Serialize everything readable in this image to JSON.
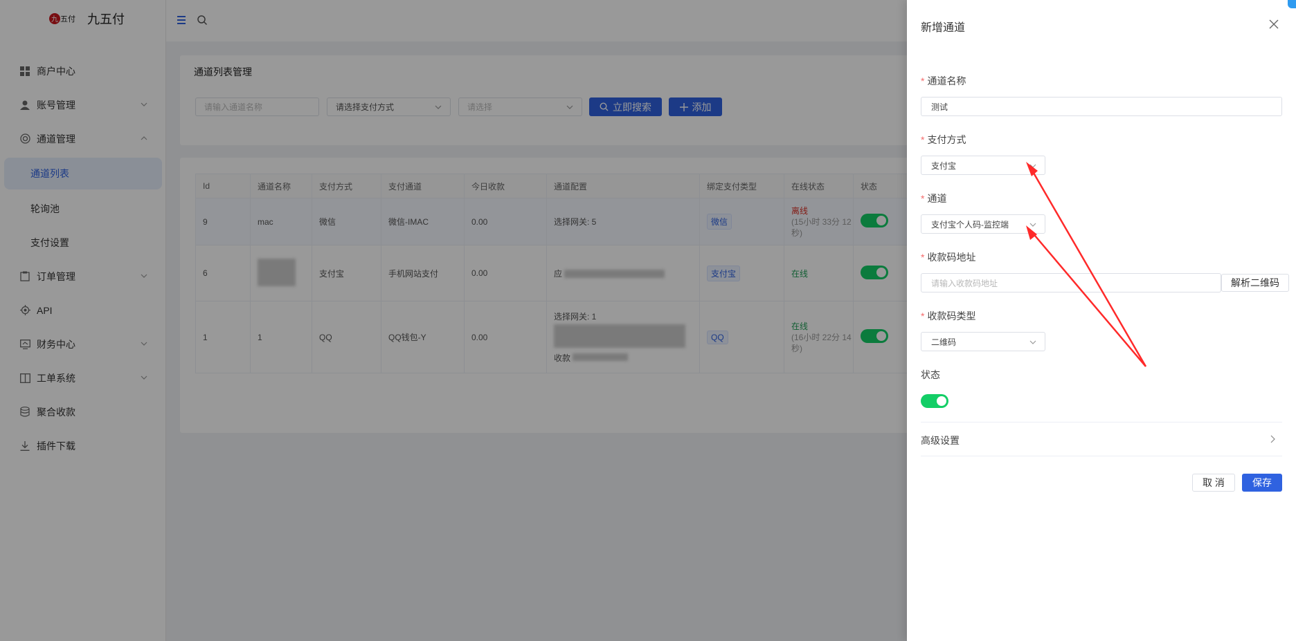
{
  "app": {
    "name": "九五付"
  },
  "sidebar": {
    "items": [
      {
        "label": "商户中心",
        "icon": "grid-icon"
      },
      {
        "label": "账号管理",
        "icon": "user-icon",
        "expandable": true
      },
      {
        "label": "通道管理",
        "icon": "channel-icon",
        "expandable": true,
        "expanded": true
      },
      {
        "label": "通道列表",
        "sub": true,
        "active": true
      },
      {
        "label": "轮询池",
        "sub": true
      },
      {
        "label": "支付设置",
        "sub": true
      },
      {
        "label": "订单管理",
        "icon": "clipboard-icon",
        "expandable": true
      },
      {
        "label": "API",
        "icon": "gear-icon"
      },
      {
        "label": "财务中心",
        "icon": "finance-icon",
        "expandable": true
      },
      {
        "label": "工单系统",
        "icon": "book-icon",
        "expandable": true
      },
      {
        "label": "聚合收款",
        "icon": "database-icon"
      },
      {
        "label": "插件下载",
        "icon": "download-icon"
      }
    ]
  },
  "filter_card": {
    "title": "通道列表管理",
    "name_placeholder": "请输入通道名称",
    "pay_method_placeholder": "请选择支付方式",
    "select_placeholder": "请选择",
    "search_label": "立即搜索",
    "add_label": "添加"
  },
  "table": {
    "headers": [
      "Id",
      "通道名称",
      "支付方式",
      "支付通道",
      "今日收款",
      "通道配置",
      "绑定支付类型",
      "在线状态",
      "状态"
    ],
    "rows": [
      {
        "id": "9",
        "name": "mac",
        "method": "微信",
        "channel": "微信-IMAC",
        "today": "0.00",
        "config": "选择网关: 5",
        "bind": "微信",
        "online": "离线",
        "online_sub": "(15小时 33分 12秒)"
      },
      {
        "id": "6",
        "name": "",
        "method": "支付宝",
        "channel": "手机网站支付",
        "today": "0.00",
        "config": "应",
        "bind": "支付宝",
        "online": "在线",
        "online_sub": ""
      },
      {
        "id": "1",
        "name": "1",
        "method": "QQ",
        "channel": "QQ钱包-Y",
        "today": "0.00",
        "config": "选择网关: 1",
        "config_tail": "收款",
        "bind": "QQ",
        "online": "在线",
        "online_sub": "(16小时 22分 14秒)"
      }
    ]
  },
  "drawer": {
    "title": "新增通道",
    "fields": {
      "name_label": "通道名称",
      "name_value": "测试",
      "method_label": "支付方式",
      "method_value": "支付宝",
      "channel_label": "通道",
      "channel_value": "支付宝个人码-监控端",
      "qr_label": "收款码地址",
      "qr_placeholder": "请输入收款码地址",
      "parse_label": "解析二维码",
      "qr_type_label": "收款码类型",
      "qr_type_value": "二维码",
      "status_label": "状态",
      "status_on": true,
      "advanced_label": "高级设置"
    },
    "cancel_label": "取 消",
    "save_label": "保存"
  },
  "colors": {
    "accent": "#2f62e0",
    "success": "#13ce66",
    "danger": "#f56c6c",
    "annotation": "#ff2a2a"
  }
}
